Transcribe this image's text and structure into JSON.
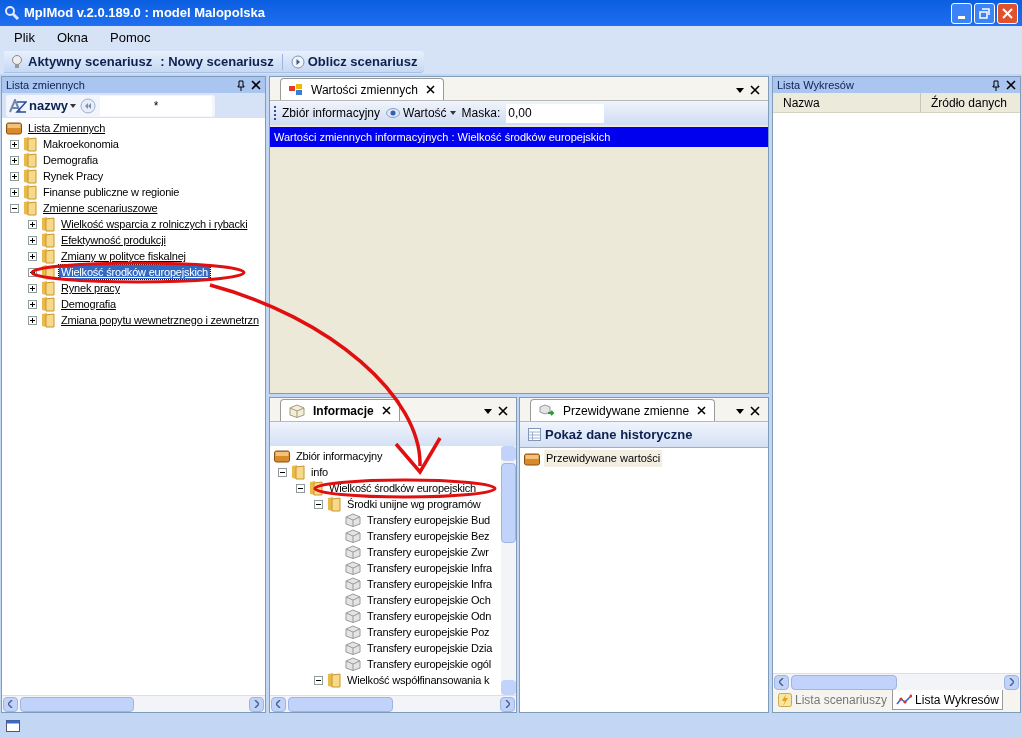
{
  "window": {
    "title": "MplMod v.2.0.189.0 : model Malopolska"
  },
  "menu": [
    "Plik",
    "Okna",
    "Pomoc"
  ],
  "toolbar": {
    "active_label": "Aktywny scenariusz",
    "active_value": ": Nowy scenariusz",
    "run_button": "Oblicz scenariusz"
  },
  "left_panel": {
    "title": "Lista zmiennych",
    "sort_button": "nazwy",
    "filter_value": "*",
    "tree": [
      {
        "label": "Lista Zmiennych",
        "kind": "root",
        "link": true,
        "selected": false,
        "children": [
          {
            "label": "Makroekonomia",
            "kind": "folder",
            "link": false,
            "selected": false,
            "expanded": false
          },
          {
            "label": "Demografia",
            "kind": "folder",
            "link": false,
            "selected": false,
            "expanded": false
          },
          {
            "label": "Rynek Pracy",
            "kind": "folder",
            "link": false,
            "selected": false,
            "expanded": false
          },
          {
            "label": "Finanse publiczne w regionie",
            "kind": "folder",
            "link": false,
            "selected": false,
            "expanded": false
          },
          {
            "label": "Zmienne scenariuszowe",
            "kind": "folder",
            "link": true,
            "selected": false,
            "expanded": true,
            "children": [
              {
                "label": "Wielkość wsparcia z rolniczych i rybacki",
                "kind": "folder",
                "link": true,
                "selected": false,
                "expanded": false
              },
              {
                "label": "Efektywność produkcji",
                "kind": "folder",
                "link": true,
                "selected": false,
                "expanded": false
              },
              {
                "label": "Zmiany w polityce fiskalnej",
                "kind": "folder",
                "link": true,
                "selected": false,
                "expanded": false
              },
              {
                "label": "Wielkość środków europejskich",
                "kind": "folder",
                "link": true,
                "selected": true,
                "expanded": false
              },
              {
                "label": "Rynek pracy",
                "kind": "folder",
                "link": true,
                "selected": false,
                "expanded": false
              },
              {
                "label": "Demografia",
                "kind": "folder",
                "link": true,
                "selected": false,
                "expanded": false
              },
              {
                "label": "Zmiana popytu wewnetrznego i zewnetrzn",
                "kind": "folder",
                "link": true,
                "selected": false,
                "expanded": false
              }
            ]
          }
        ]
      }
    ]
  },
  "values_panel": {
    "tab": "Wartości zmiennych",
    "set_label": "Zbiór informacyjny",
    "view_button": "Wartość",
    "mask_label": "Maska:",
    "mask_value": "0,00",
    "header": "Wartości zmiennych informacyjnych : Wielkość środków europejskich"
  },
  "info_panel": {
    "tab": "Informacje",
    "tree": [
      {
        "label": "Zbiór informacyjny",
        "kind": "root",
        "link": false,
        "selected": false,
        "children": [
          {
            "label": "info",
            "kind": "folder",
            "link": false,
            "selected": false,
            "expanded": true,
            "children": [
              {
                "label": "Wielkość środków europejskich",
                "kind": "folder",
                "link": false,
                "selected": false,
                "expanded": true,
                "children": [
                  {
                    "label": "Środki unijne wg programów",
                    "kind": "folder",
                    "link": false,
                    "selected": false,
                    "expanded": true,
                    "children": [
                      {
                        "label": "Transfery europejskie Bud",
                        "kind": "cube",
                        "link": false,
                        "selected": false
                      },
                      {
                        "label": "Transfery europejskie Bez",
                        "kind": "cube",
                        "link": false,
                        "selected": false
                      },
                      {
                        "label": "Transfery europejskie Zwr",
                        "kind": "cube",
                        "link": false,
                        "selected": false
                      },
                      {
                        "label": "Transfery europejskie Infra",
                        "kind": "cube",
                        "link": false,
                        "selected": false
                      },
                      {
                        "label": "Transfery europejskie Infra",
                        "kind": "cube",
                        "link": false,
                        "selected": false
                      },
                      {
                        "label": "Transfery europejskie Och",
                        "kind": "cube",
                        "link": false,
                        "selected": false
                      },
                      {
                        "label": "Transfery europejskie Odn",
                        "kind": "cube",
                        "link": false,
                        "selected": false
                      },
                      {
                        "label": "Transfery europejskie Poz",
                        "kind": "cube",
                        "link": false,
                        "selected": false
                      },
                      {
                        "label": "Transfery europejskie Dzia",
                        "kind": "cube",
                        "link": false,
                        "selected": false
                      },
                      {
                        "label": "Transfery europejskie ogól",
                        "kind": "cube",
                        "link": false,
                        "selected": false
                      }
                    ]
                  },
                  {
                    "label": "Wielkość współfinansowania k",
                    "kind": "folder",
                    "link": false,
                    "selected": false,
                    "expanded": true
                  }
                ]
              }
            ]
          }
        ]
      }
    ]
  },
  "forecast_panel": {
    "tab": "Przewidywane zmienne",
    "history_button": "Pokaż dane historyczne",
    "items": [
      "Przewidywane wartości"
    ]
  },
  "charts_panel": {
    "title": "Lista Wykresów",
    "columns": [
      "Nazwa",
      "Źródło danych"
    ],
    "tabs": [
      {
        "label": "Lista scenariuszy",
        "kind": "scenarios",
        "selected": false
      },
      {
        "label": "Lista Wykresów",
        "kind": "charts",
        "selected": true
      }
    ]
  }
}
